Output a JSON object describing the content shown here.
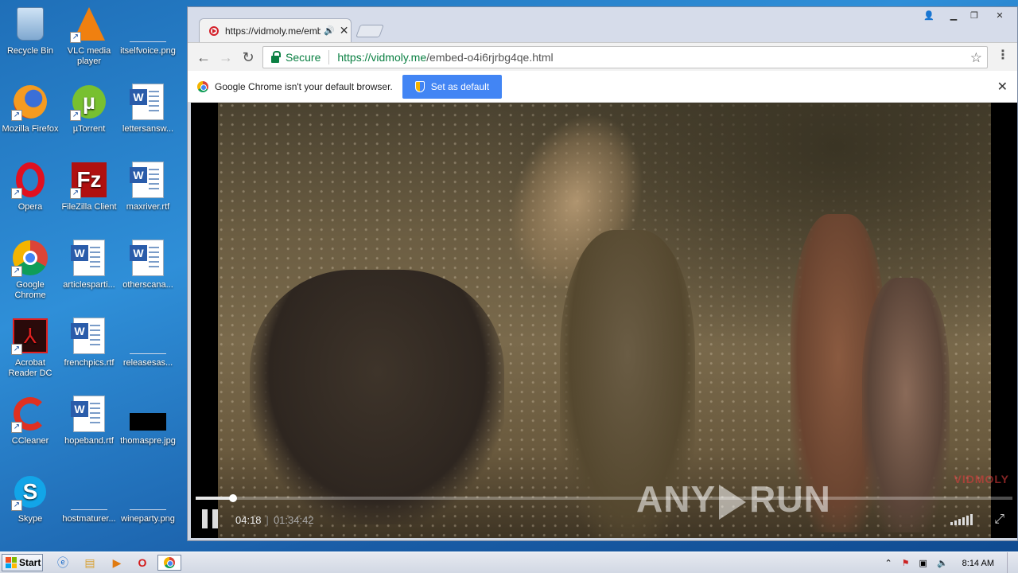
{
  "desktop": {
    "icons": [
      {
        "label": "Recycle Bin",
        "icon": "recycle-bin-icon"
      },
      {
        "label": "VLC media player",
        "icon": "vlc-icon"
      },
      {
        "label": "itselfvoice.png",
        "icon": "blank-file-icon"
      },
      {
        "label": "Mozilla Firefox",
        "icon": "firefox-icon"
      },
      {
        "label": "µTorrent",
        "icon": "utorrent-icon"
      },
      {
        "label": "lettersansw...",
        "icon": "word-doc-icon"
      },
      {
        "label": "Opera",
        "icon": "opera-icon"
      },
      {
        "label": "FileZilla Client",
        "icon": "filezilla-icon"
      },
      {
        "label": "maxriver.rtf",
        "icon": "word-doc-icon"
      },
      {
        "label": "Google Chrome",
        "icon": "chrome-icon"
      },
      {
        "label": "articlesparti...",
        "icon": "word-doc-icon"
      },
      {
        "label": "otherscana...",
        "icon": "word-doc-icon"
      },
      {
        "label": "Acrobat Reader DC",
        "icon": "acrobat-icon"
      },
      {
        "label": "frenchpics.rtf",
        "icon": "word-doc-icon"
      },
      {
        "label": "releasesas...",
        "icon": "blank-file-icon"
      },
      {
        "label": "CCleaner",
        "icon": "ccleaner-icon"
      },
      {
        "label": "hopeband.rtf",
        "icon": "word-doc-icon"
      },
      {
        "label": "thomaspre.jpg",
        "icon": "image-file-icon"
      },
      {
        "label": "Skype",
        "icon": "skype-icon"
      },
      {
        "label": "hostmaturer...",
        "icon": "blank-file-icon"
      },
      {
        "label": "wineparty.png",
        "icon": "blank-file-icon"
      }
    ]
  },
  "browser": {
    "tab": {
      "title": "https://vidmoly.me/emb",
      "audio_icon": "speaker-icon"
    },
    "omnibox": {
      "secure_label": "Secure",
      "url_scheme_host": "https://vidmoly.me",
      "url_path": "/embed-o4i6rjrbg4qe.html"
    },
    "infobar": {
      "message": "Google Chrome isn't your default browser.",
      "button": "Set as default"
    },
    "colors": {
      "secure_green": "#0b8043",
      "button_blue": "#4285f4"
    }
  },
  "video": {
    "current_time": "04:18",
    "separator": "|",
    "duration": "01:34:42",
    "progress": 0.046,
    "brand": "VIDMOLY",
    "watermark": "ANY RUN"
  },
  "taskbar": {
    "start_label": "Start",
    "clock": "8:14 AM"
  }
}
